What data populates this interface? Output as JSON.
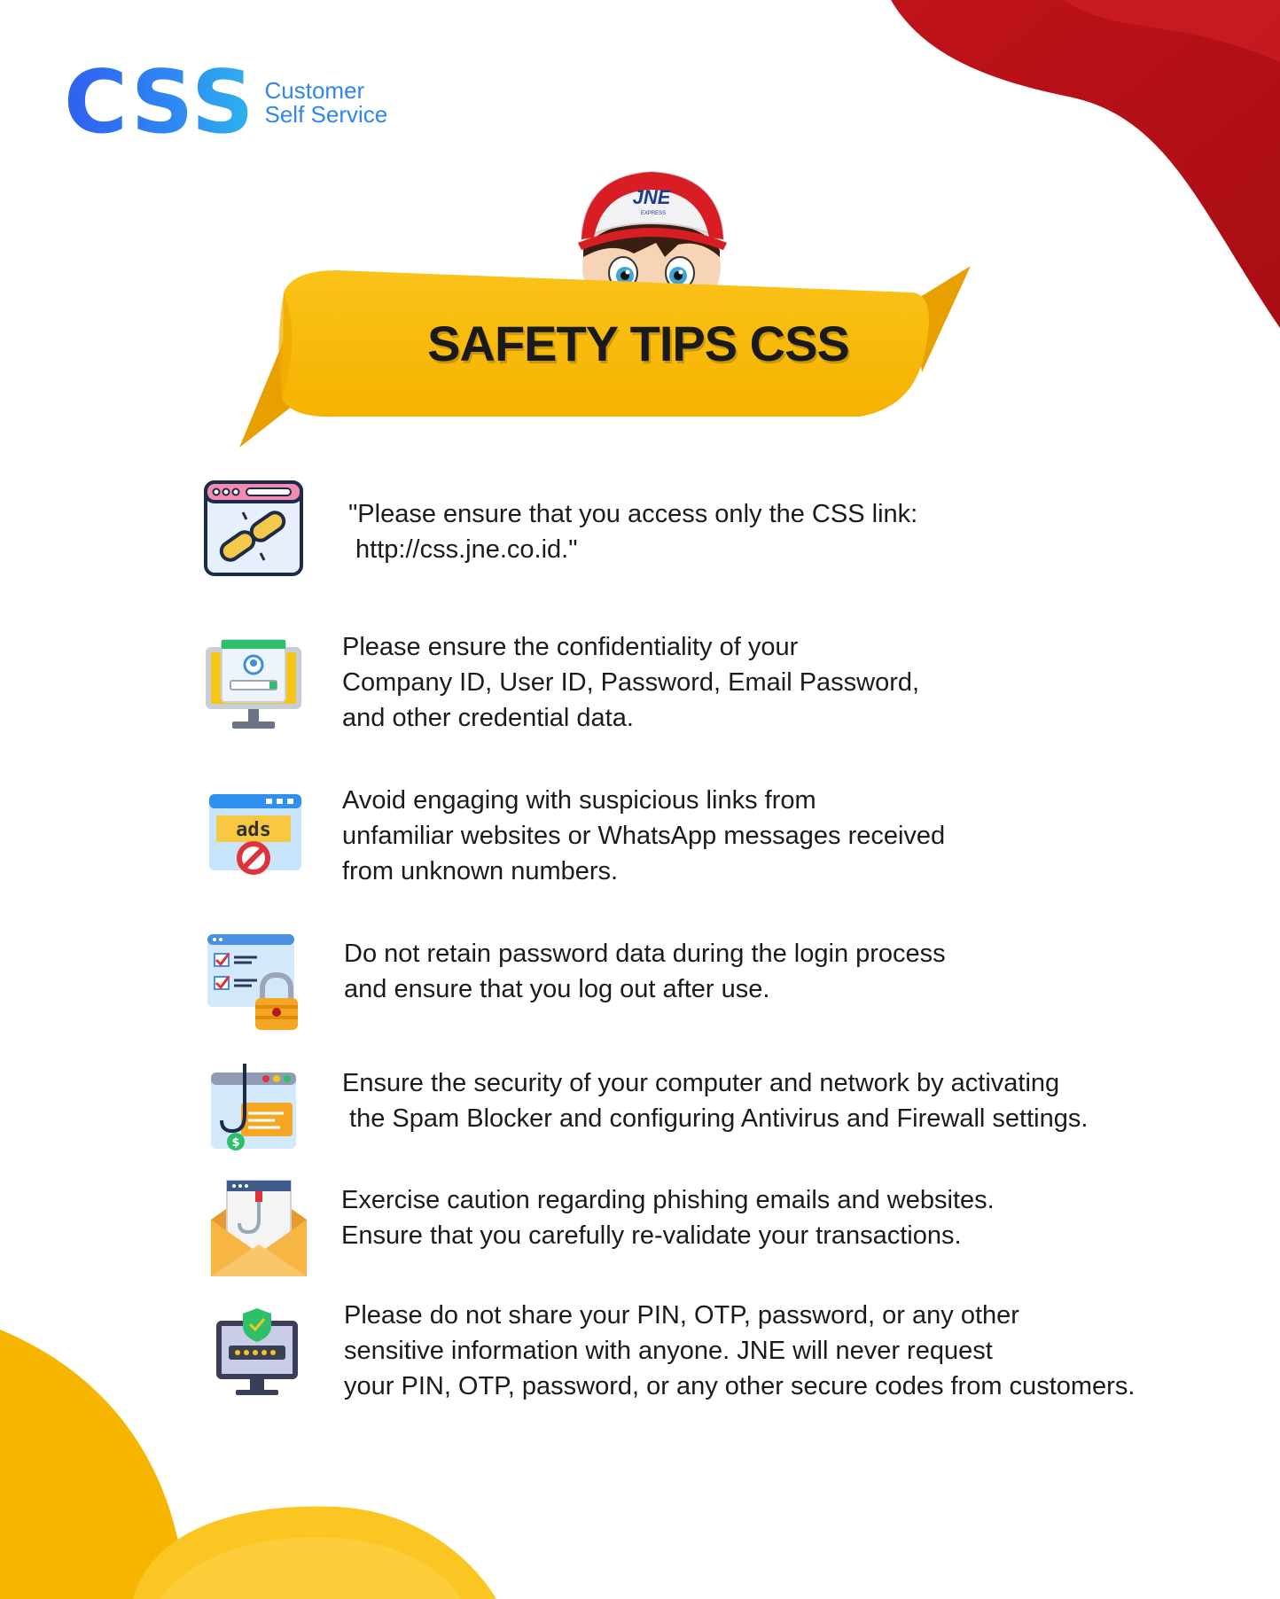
{
  "logo": {
    "mark": "CSS",
    "line1": "Customer",
    "line2": "Self Service"
  },
  "mascot": {
    "cap_text": "JNE",
    "cap_subtext": "EXPRESS"
  },
  "banner": {
    "title": "SAFETY TIPS CSS"
  },
  "tips": [
    {
      "icon": "broken-link-icon",
      "text": "\"Please ensure that you access only the CSS link:\n http://css.jne.co.id.\""
    },
    {
      "icon": "login-monitor-icon",
      "text": "Please ensure the confidentiality of your\nCompany ID, User ID, Password, Email Password,\nand other credential data."
    },
    {
      "icon": "blocked-ads-icon",
      "text": "Avoid engaging with suspicious links from\nunfamiliar websites or WhatsApp messages received\nfrom unknown numbers."
    },
    {
      "icon": "checklist-lock-icon",
      "text": "Do not retain password data during the login process\nand ensure that you log out after use."
    },
    {
      "icon": "phishing-hook-icon",
      "text": "Ensure the security of your computer and network by activating\n the Spam Blocker and configuring Antivirus and Firewall settings."
    },
    {
      "icon": "phishing-email-icon",
      "text": "Exercise caution regarding phishing emails and websites.\nEnsure that you carefully re-validate your transactions."
    },
    {
      "icon": "secure-monitor-icon",
      "text": "Please do not share your PIN, OTP, password, or any other\nsensitive information with anyone. JNE will never request\nyour PIN, OTP, password, or any other secure codes from customers."
    }
  ],
  "colors": {
    "brand_blue": "#2f86f2",
    "accent_red": "#c8141c",
    "accent_yellow": "#f7b500",
    "banner_yellow": "#fbc21a"
  }
}
